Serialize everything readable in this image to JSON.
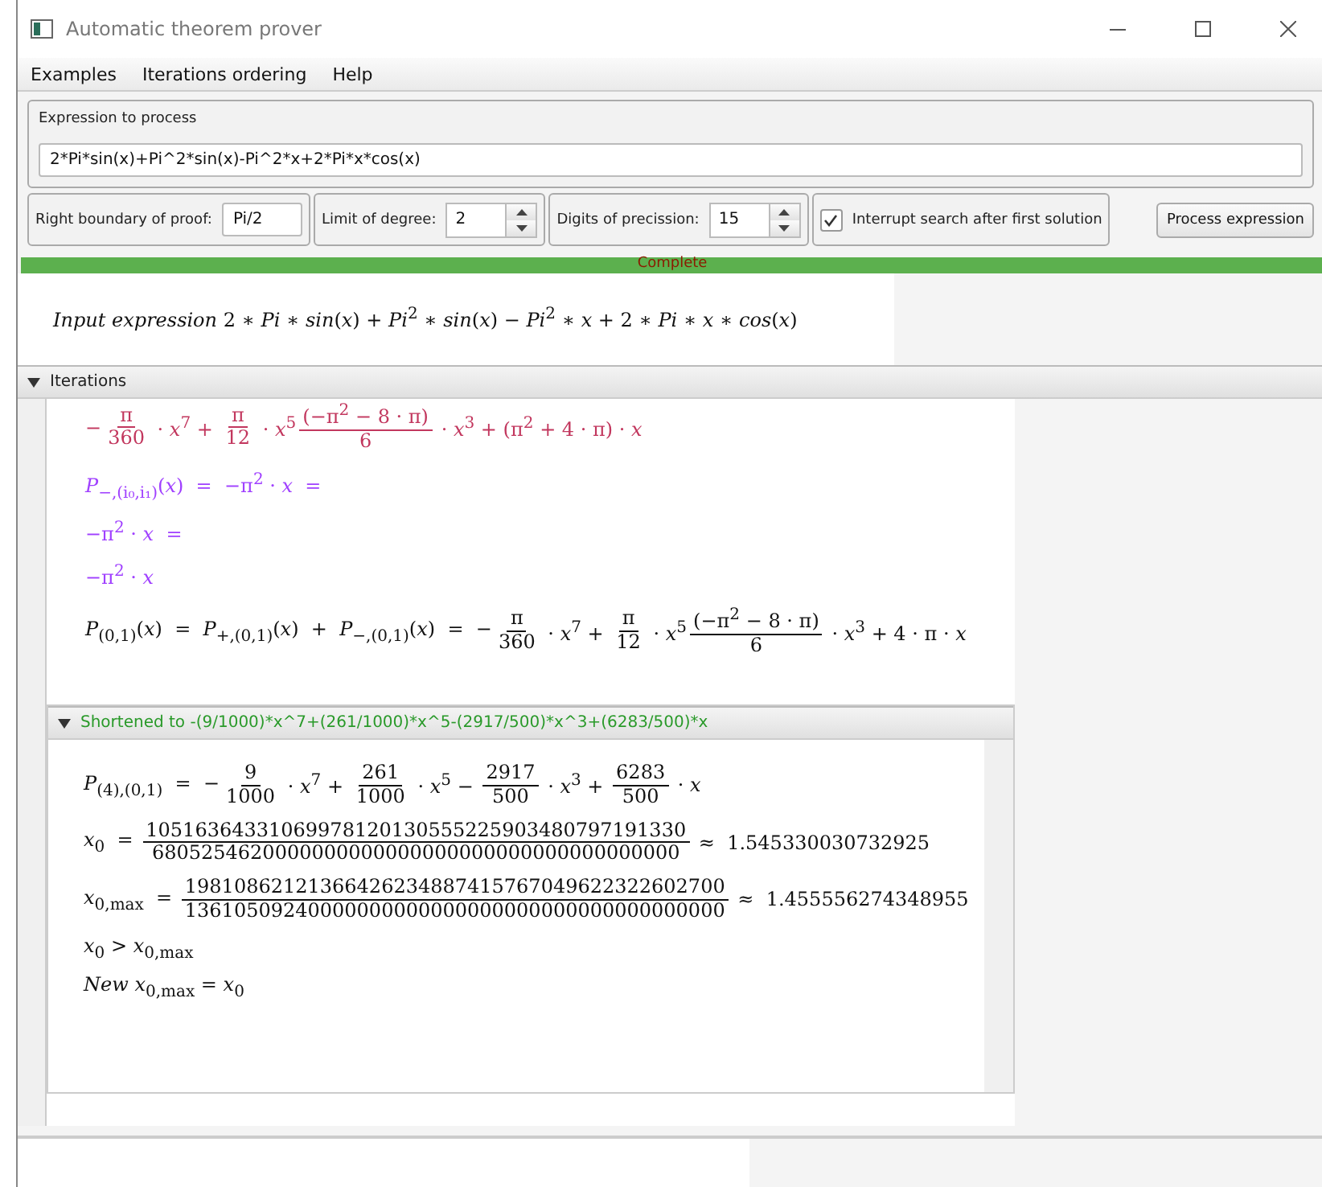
{
  "window": {
    "title": "Automatic theorem prover"
  },
  "menu": [
    "Examples",
    "Iterations ordering",
    "Help"
  ],
  "expression": {
    "label": "Expression to process",
    "value": "2*Pi*sin(x)+Pi^2*sin(x)-Pi^2*x+2*Pi*x*cos(x)"
  },
  "controls": [
    {
      "kind": "text",
      "label": "Right boundary of proof:",
      "value": "Pi/2"
    },
    {
      "kind": "spinner",
      "label": "Limit of degree:",
      "value": "2"
    },
    {
      "kind": "spinner",
      "label": "Digits of precission:",
      "value": "15"
    },
    {
      "kind": "checkbox",
      "label": "Interrupt search after first solution",
      "checked": true
    }
  ],
  "process_button": "Process expression",
  "progress": {
    "label": "Complete",
    "level": 1
  },
  "input_formula": {
    "color": "#111111",
    "parts": [
      {
        "kind": "text",
        "text": "*Input expression* 2 ∗ *Pi* ∗ *sin*(*x*) + *Pi*$^{2}$ ∗ *sin*(*x*) − *Pi*$^{2}$ ∗ *x* + 2 ∗ *Pi* ∗ *x* ∗ *cos*(*x*)"
      }
    ]
  },
  "iterations": {
    "title": "Iterations",
    "expanded": true,
    "formulas": [
      {
        "color": "#c2375e",
        "parts": [
          {
            "kind": "text",
            "text": "−"
          },
          {
            "kind": "frac",
            "num": "π",
            "den": "360"
          },
          {
            "kind": "text",
            "text": " · *x*$^{7}$ + "
          },
          {
            "kind": "frac",
            "num": "π",
            "den": "12"
          },
          {
            "kind": "text",
            "text": " · *x*$^{5}$"
          },
          {
            "kind": "frac",
            "num": "(−π$^{2}$ − 8 · π)",
            "den": "6"
          },
          {
            "kind": "text",
            "text": " · *x*$^{3}$ + (π$^{2}$ + 4 · π) · *x*"
          }
        ]
      },
      {
        "color": "#a040ff",
        "parts": [
          {
            "kind": "text",
            "text": "*P*$_{−,(i₀,i₁)}$(*x*)  =  −π$^{2}$ · *x*  ="
          }
        ]
      },
      {
        "color": "#a040ff",
        "parts": [
          {
            "kind": "text",
            "text": "−π$^{2}$ · *x*  ="
          }
        ]
      },
      {
        "color": "#a040ff",
        "parts": [
          {
            "kind": "text",
            "text": "−π$^{2}$ · *x*"
          }
        ]
      },
      {
        "color": "#111111",
        "parts": [
          {
            "kind": "text",
            "text": "*P*$_{(0,1)}$(*x*)  =  *P*$_{+,(0,1)}$(*x*)  +  *P*$_{−,(0,1)}$(*x*)  =  −"
          },
          {
            "kind": "frac",
            "num": "π",
            "den": "360"
          },
          {
            "kind": "text",
            "text": " · *x*$^{7}$ + "
          },
          {
            "kind": "frac",
            "num": "π",
            "den": "12"
          },
          {
            "kind": "text",
            "text": " · *x*$^{5}$"
          },
          {
            "kind": "frac",
            "num": "(−π$^{2}$ − 8 · π)",
            "den": "6"
          },
          {
            "kind": "text",
            "text": " · *x*$^{3}$ + 4 · π · *x*"
          }
        ]
      }
    ],
    "subsection": {
      "title": "Shortened to -(9/1000)*x^7+(261/1000)*x^5-(2917/500)*x^3+(6283/500)*x",
      "expanded": true,
      "formulas": [
        {
          "color": "#111111",
          "parts": [
            {
              "kind": "text",
              "text": "*P*$_{(4),(0,1)}$  =  −"
            },
            {
              "kind": "frac",
              "num": "9",
              "den": "1000"
            },
            {
              "kind": "text",
              "text": " · *x*$^{7}$ + "
            },
            {
              "kind": "frac",
              "num": "261",
              "den": "1000"
            },
            {
              "kind": "text",
              "text": " · *x*$^{5}$ − "
            },
            {
              "kind": "frac",
              "num": "2917",
              "den": "500"
            },
            {
              "kind": "text",
              "text": " · *x*$^{3}$ + "
            },
            {
              "kind": "frac",
              "num": "6283",
              "den": "500"
            },
            {
              "kind": "text",
              "text": " · *x*"
            }
          ]
        },
        {
          "color": "#111111",
          "parts": [
            {
              "kind": "text",
              "text": "*x*$_{0}$  = "
            },
            {
              "kind": "frac",
              "num": "10516364331069978120130555225903480797191330",
              "den": "6805254620000000000000000000000000000000000"
            },
            {
              "kind": "text",
              "text": " ≈  1.545330030732925"
            }
          ]
        },
        {
          "color": "#111111",
          "parts": [
            {
              "kind": "text",
              "text": "*x*$_{0,max}$  = "
            },
            {
              "kind": "frac",
              "num": "19810862121366426234887415767049622322602700",
              "den": "13610509240000000000000000000000000000000000"
            },
            {
              "kind": "text",
              "text": " ≈  1.455556274348955"
            }
          ]
        },
        {
          "color": "#111111",
          "parts": [
            {
              "kind": "text",
              "text": "*x*$_{0}$ > *x*$_{0,max}$"
            }
          ]
        },
        {
          "color": "#111111",
          "parts": [
            {
              "kind": "text",
              "text": "*New* *x*$_{0,max}$ = *x*$_{0}$"
            }
          ]
        }
      ]
    }
  }
}
